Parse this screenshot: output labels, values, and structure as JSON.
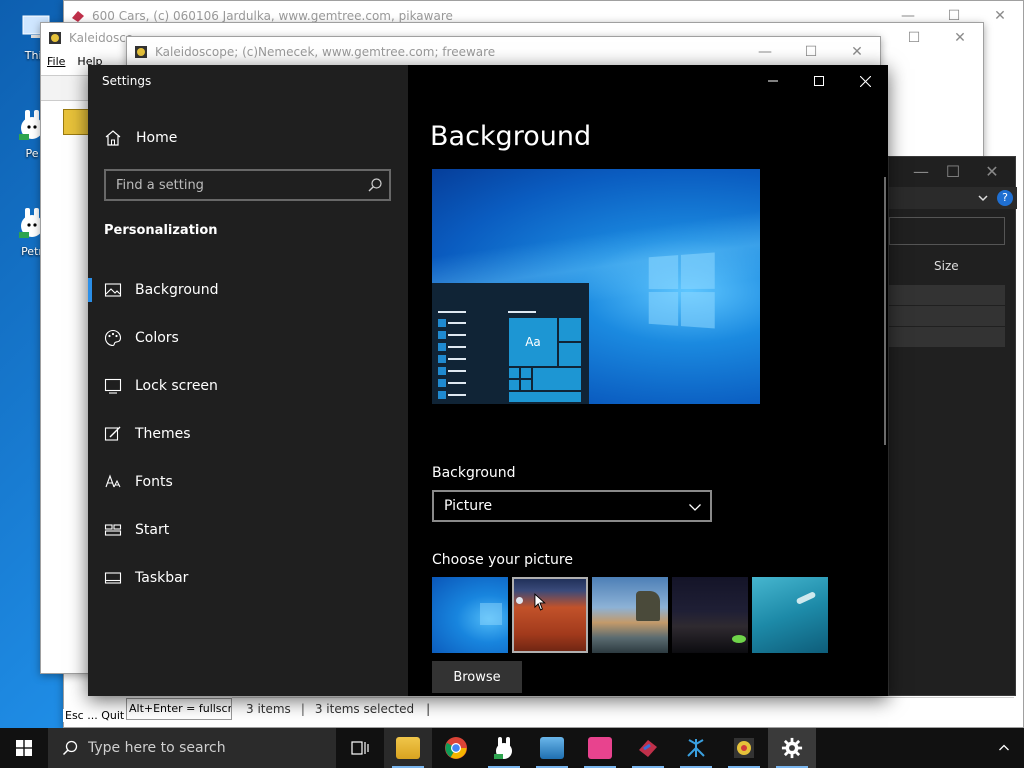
{
  "desktop": {
    "icons": [
      {
        "label": "This"
      },
      {
        "label": "Pe"
      },
      {
        "label": "Petr"
      }
    ]
  },
  "back_windows": {
    "cars": {
      "title": "600 Cars, (c) 060106 Jardulka, www.gemtree.com, pikaware"
    },
    "kaleido_partial": {
      "title": "Kaleidosco",
      "menu": [
        "File",
        "Help"
      ],
      "bottom_hints": {
        "esc_quit": "Esc ... Quit",
        "alt_enter": "Alt+Enter = fullscre"
      }
    },
    "kaleido": {
      "title": "Kaleidoscope; (c)Nemecek, www.gemtree.com; freeware"
    },
    "explorer": {
      "column_size": "Size"
    }
  },
  "settings": {
    "window_title": "Settings",
    "home_label": "Home",
    "search_placeholder": "Find a setting",
    "section_title": "Personalization",
    "nav": [
      {
        "label": "Background",
        "icon": "picture-icon",
        "active": true
      },
      {
        "label": "Colors",
        "icon": "palette-icon",
        "active": false
      },
      {
        "label": "Lock screen",
        "icon": "lock-screen-icon",
        "active": false
      },
      {
        "label": "Themes",
        "icon": "brush-icon",
        "active": false
      },
      {
        "label": "Fonts",
        "icon": "font-icon",
        "active": false
      },
      {
        "label": "Start",
        "icon": "start-icon",
        "active": false
      },
      {
        "label": "Taskbar",
        "icon": "taskbar-icon",
        "active": false
      }
    ],
    "page_title": "Background",
    "preview_tile_text": "Aa",
    "background_label": "Background",
    "background_value": "Picture",
    "choose_label": "Choose your picture",
    "browse_label": "Browse",
    "accent_color": "#2b8fe8"
  },
  "statusbar": {
    "items_count": "3 items",
    "items_selected": "3 items selected",
    "cursor": "|"
  },
  "taskbar": {
    "search_placeholder": "Type here to search",
    "apps": [
      {
        "name": "task-view-icon"
      },
      {
        "name": "file-explorer-icon"
      },
      {
        "name": "chrome-icon"
      },
      {
        "name": "petr-icon"
      },
      {
        "name": "shark-icon"
      },
      {
        "name": "gift-icon"
      },
      {
        "name": "cars-icon"
      },
      {
        "name": "gemtree-icon"
      },
      {
        "name": "kaleidoscope-icon"
      },
      {
        "name": "settings-icon"
      }
    ]
  }
}
